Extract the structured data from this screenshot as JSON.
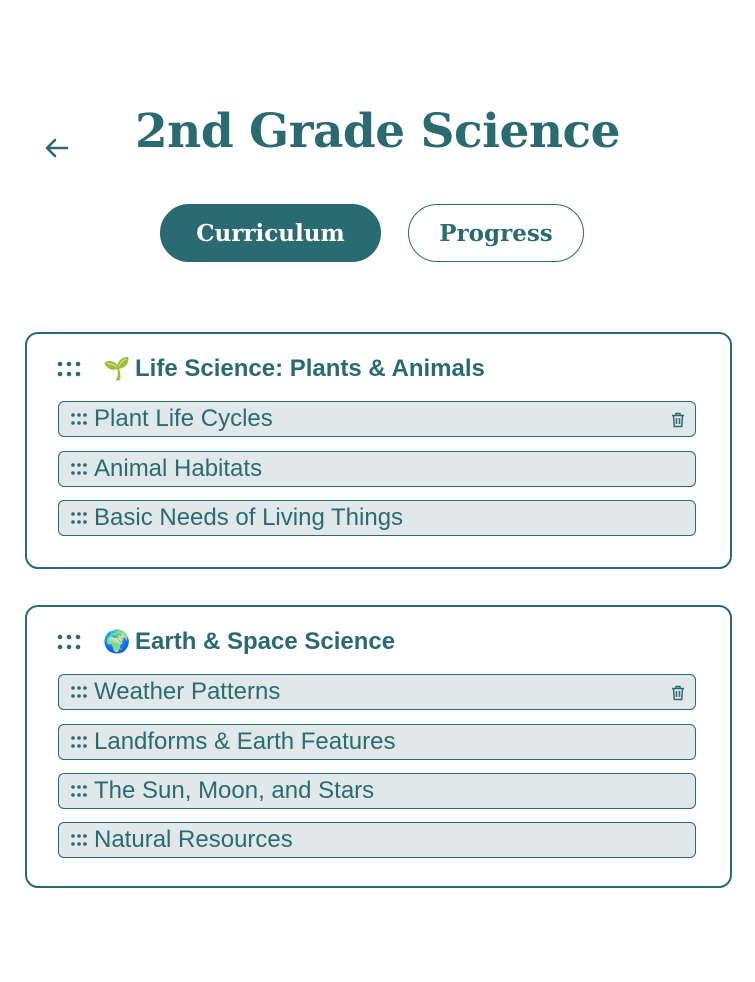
{
  "header": {
    "title": "2nd Grade Science",
    "back_icon": "arrow-left-icon"
  },
  "tabs": [
    {
      "label": "Curriculum",
      "active": true
    },
    {
      "label": "Progress",
      "active": false
    }
  ],
  "colors": {
    "primary": "#2a6b72",
    "lesson_background": "#e1e8e9",
    "background": "#ffffff"
  },
  "units": [
    {
      "emoji": "🌱",
      "title": "Life Science: Plants & Animals",
      "lessons": [
        {
          "label": "Plant Life Cycles",
          "shows_delete": true
        },
        {
          "label": "Animal Habitats",
          "shows_delete": false
        },
        {
          "label": "Basic Needs of Living Things",
          "shows_delete": false
        }
      ]
    },
    {
      "emoji": "🌍",
      "title": "Earth & Space Science",
      "lessons": [
        {
          "label": "Weather Patterns",
          "shows_delete": true
        },
        {
          "label": "Landforms & Earth Features",
          "shows_delete": false
        },
        {
          "label": "The Sun, Moon, and Stars",
          "shows_delete": false
        },
        {
          "label": "Natural Resources",
          "shows_delete": false
        }
      ]
    }
  ]
}
